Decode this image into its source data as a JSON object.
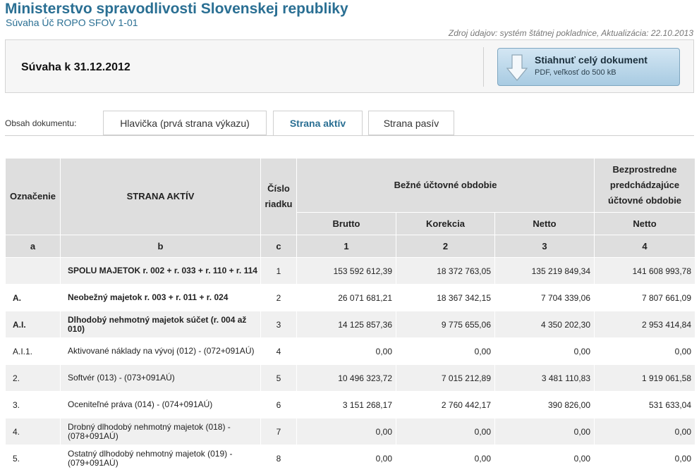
{
  "header": {
    "title": "Ministerstvo spravodlivosti Slovenskej republiky",
    "subtitle": "Súvaha Úč ROPO SFOV 1-01",
    "source": "Zdroj údajov: systém štátnej pokladnice, Aktualizácia: 22.10.2013"
  },
  "document": {
    "title": "Súvaha k 31.12.2012",
    "download_label": "Stiahnuť celý dokument",
    "download_sub": "PDF, veľkosť do 500 kB",
    "download_icon": "download-arrow-icon"
  },
  "tabs": {
    "label": "Obsah dokumentu:",
    "items": [
      {
        "label": "Hlavička (prvá strana výkazu)"
      },
      {
        "label": "Strana aktív",
        "active": true
      },
      {
        "label": "Strana pasív"
      }
    ]
  },
  "table": {
    "headers": {
      "oznacenie": "Označenie",
      "strana": "STRANA AKTÍV",
      "cislo": "Číslo riadku",
      "bezne": "Bežné účtovné obdobie",
      "predchadzajuce": "Bezprostredne predchádzajúce účtovné obdobie",
      "brutto": "Brutto",
      "korekcia": "Korekcia",
      "netto": "Netto",
      "netto_prev": "Netto"
    },
    "letters": [
      "a",
      "b",
      "c",
      "1",
      "2",
      "3",
      "4"
    ],
    "rows": [
      {
        "id": "",
        "name": "SPOLU MAJETOK r. 002 + r. 033 + r. 110 + r. 114",
        "no": "1",
        "brutto": "153 592 612,39",
        "korekcia": "18 372 763,05",
        "netto": "135 219 849,34",
        "prev": "141 608 993,78"
      },
      {
        "id": "A.",
        "name": "Neobežný majetok r. 003 + r. 011 + r. 024",
        "no": "2",
        "brutto": "26 071 681,21",
        "korekcia": "18 367 342,15",
        "netto": "7 704 339,06",
        "prev": "7 807 661,09"
      },
      {
        "id": "A.I.",
        "name": "Dlhodobý nehmotný majetok súčet (r. 004 až 010)",
        "no": "3",
        "brutto": "14 125 857,36",
        "korekcia": "9 775 655,06",
        "netto": "4 350 202,30",
        "prev": "2 953 414,84"
      },
      {
        "id": "A.I.1.",
        "name": "Aktivované náklady na vývoj (012) - (072+091AÚ)",
        "no": "4",
        "brutto": "0,00",
        "korekcia": "0,00",
        "netto": "0,00",
        "prev": "0,00"
      },
      {
        "id": "2.",
        "name": "Softvér (013) - (073+091AÚ)",
        "no": "5",
        "brutto": "10 496 323,72",
        "korekcia": "7 015 212,89",
        "netto": "3 481 110,83",
        "prev": "1 919 061,58"
      },
      {
        "id": "3.",
        "name": "Oceniteľné práva (014) - (074+091AÚ)",
        "no": "6",
        "brutto": "3 151 268,17",
        "korekcia": "2 760 442,17",
        "netto": "390 826,00",
        "prev": "531 633,04"
      },
      {
        "id": "4.",
        "name": "Drobný dlhodobý nehmotný majetok (018) - (078+091AÚ)",
        "no": "7",
        "brutto": "0,00",
        "korekcia": "0,00",
        "netto": "0,00",
        "prev": "0,00"
      },
      {
        "id": "5.",
        "name": "Ostatný dlhodobý nehmotný majetok (019) - (079+091AÚ)",
        "no": "8",
        "brutto": "0,00",
        "korekcia": "0,00",
        "netto": "0,00",
        "prev": "0,00"
      }
    ]
  }
}
